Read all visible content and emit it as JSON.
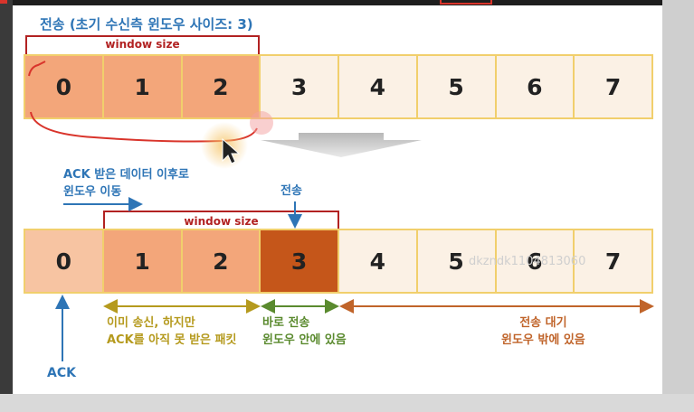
{
  "title": "전송 (초기 수신측 윈도우 사이즈: 3)",
  "window_size_label": "window size",
  "top_row": {
    "cells": [
      {
        "label": "0",
        "state": "in-window"
      },
      {
        "label": "1",
        "state": "in-window"
      },
      {
        "label": "2",
        "state": "in-window"
      },
      {
        "label": "3",
        "state": "waiting"
      },
      {
        "label": "4",
        "state": "waiting"
      },
      {
        "label": "5",
        "state": "waiting"
      },
      {
        "label": "6",
        "state": "waiting"
      },
      {
        "label": "7",
        "state": "waiting"
      }
    ]
  },
  "bottom_row": {
    "cells": [
      {
        "label": "0",
        "state": "acked"
      },
      {
        "label": "1",
        "state": "sent-unacked"
      },
      {
        "label": "2",
        "state": "sent-unacked"
      },
      {
        "label": "3",
        "state": "sending"
      },
      {
        "label": "4",
        "state": "waiting"
      },
      {
        "label": "5",
        "state": "waiting"
      },
      {
        "label": "6",
        "state": "waiting"
      },
      {
        "label": "7",
        "state": "waiting"
      }
    ]
  },
  "notes": {
    "ack_move_line1": "ACK 받은 데이터 이후로",
    "ack_move_line2": "윈도우 이동",
    "send_label": "전송",
    "ack_label": "ACK",
    "sent_unacked_line1": "이미 송신, 하지만",
    "sent_unacked_line2": "ACK를 아직 못 받은 패킷",
    "send_now_line1": "바로 전송",
    "send_now_line2": "윈도우 안에 있음",
    "waiting_line1": "전송 대기",
    "waiting_line2": "윈도우 밖에 있음"
  },
  "watermark": "dkzndk1104813060",
  "colors": {
    "in_window": "#f3a67a",
    "waiting": "#fbf1e5",
    "acked": "#f7c4a2",
    "sending": "#c5561a",
    "cell_border": "#f1cf6c",
    "bracket": "#b22222",
    "title_blue": "#2e75b6",
    "annot_olive": "#b59a1e",
    "annot_green": "#5a8a2e",
    "annot_brown": "#c0642a"
  }
}
